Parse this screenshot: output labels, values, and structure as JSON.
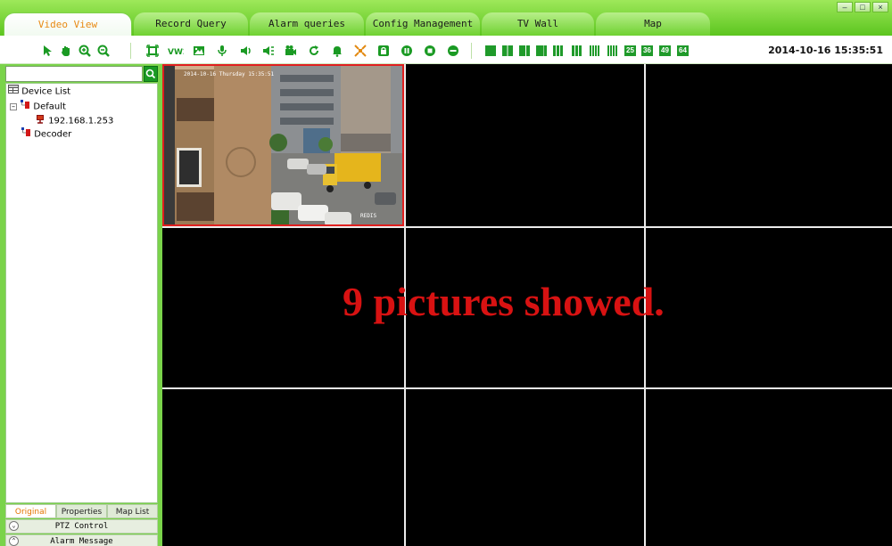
{
  "tabs": [
    {
      "label": "Video View",
      "active": true
    },
    {
      "label": "Record Query",
      "active": false
    },
    {
      "label": "Alarm queries",
      "active": false
    },
    {
      "label": "Config Management",
      "active": false
    },
    {
      "label": "TV Wall",
      "active": false
    },
    {
      "label": "Map",
      "active": false
    }
  ],
  "window_controls": {
    "minimize": "–",
    "restore": "□",
    "close": "×"
  },
  "toolbar": {
    "datetime": "2014-10-16 15:35:51",
    "icons": [
      "select-pointer-icon",
      "pan-hand-icon",
      "zoom-in-icon",
      "zoom-out-icon",
      "fullscreen-icon",
      "ratio-icon",
      "snapshot-icon",
      "microphone-icon",
      "speaker-icon",
      "broadcast-icon",
      "record-icon",
      "refresh-icon",
      "alarm-bell-icon",
      "fit-icon",
      "lock-icon",
      "pause-icon",
      "stop-icon",
      "close-all-icon"
    ],
    "layouts": [
      "1",
      "4",
      "6",
      "8",
      "9",
      "13",
      "16",
      "20",
      "25",
      "36",
      "49",
      "64"
    ],
    "accent_color": "#1f9a2a"
  },
  "sidebar": {
    "search": {
      "placeholder": ""
    },
    "tree": {
      "root": "Device List",
      "group_default": "Default",
      "device_ip": "192.168.1.253",
      "group_decoder": "Decoder"
    },
    "bottom_tabs": [
      {
        "label": "Original",
        "active": true
      },
      {
        "label": "Properties",
        "active": false
      },
      {
        "label": "Map List",
        "active": false
      }
    ],
    "sections": {
      "ptz": "PTZ Control",
      "alarm": "Alarm Message"
    }
  },
  "video": {
    "grid": "3x3",
    "selected_cell": 1,
    "cam_timestamp": "2014-10-16 Thursday 15:35:51",
    "cam_label": "REDIS",
    "overlay_text": "9 pictures showed.",
    "overlay_color": "#d81212"
  }
}
